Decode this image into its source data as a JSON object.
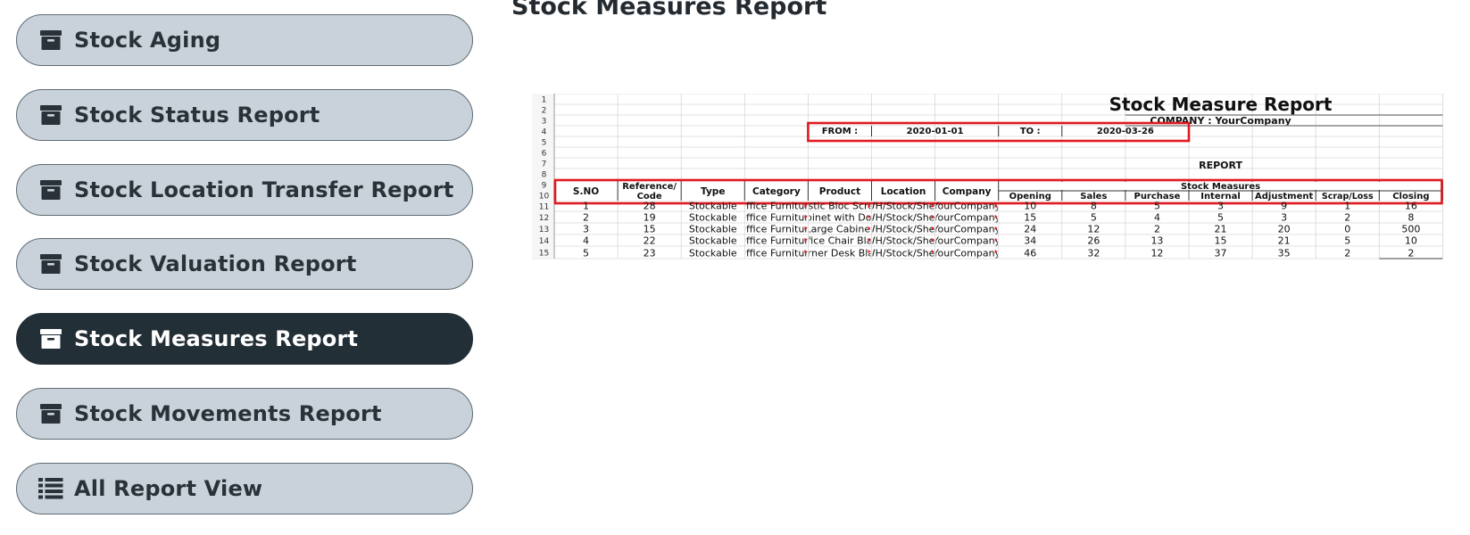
{
  "sidebar": {
    "items": [
      {
        "label": "Stock Aging",
        "icon": "archive-icon",
        "active": false
      },
      {
        "label": "Stock Status Report",
        "icon": "archive-icon",
        "active": false
      },
      {
        "label": "Stock Location Transfer Report",
        "icon": "archive-icon",
        "active": false
      },
      {
        "label": "Stock Valuation Report",
        "icon": "archive-icon",
        "active": false
      },
      {
        "label": "Stock Measures Report",
        "icon": "archive-icon",
        "active": true
      },
      {
        "label": "Stock Movements Report",
        "icon": "archive-icon",
        "active": false
      },
      {
        "label": "All Report View",
        "icon": "list-icon",
        "active": false
      }
    ]
  },
  "page": {
    "title": "Stock Measures Report"
  },
  "spreadsheet": {
    "row_numbers": [
      "1",
      "2",
      "3",
      "4",
      "5",
      "6",
      "7",
      "8",
      "9",
      "10",
      "11",
      "12",
      "13",
      "14",
      "15"
    ],
    "title": "Stock Measure Report",
    "company": "COMPANY : YourCompany",
    "from_label": "FROM :",
    "from_value": "2020-01-01",
    "to_label": "TO :",
    "to_value": "2020-03-26",
    "report_label": "REPORT",
    "group_header": "Stock Measures",
    "columns": [
      "S.NO",
      "Reference/ Code",
      "Type",
      "Category",
      "Product",
      "Location",
      "Company"
    ],
    "measure_columns": [
      "Opening",
      "Sales",
      "Purchase",
      "Internal",
      "Adjustment",
      "Scrap/Loss",
      "Closing"
    ],
    "rows": [
      [
        "1",
        "28",
        "Stockable",
        "Office Furniture",
        "Plastic Bloc Screen",
        "WH/Stock/Shelf",
        "YourCompany",
        "10",
        "8",
        "5",
        "3",
        "9",
        "1",
        "16"
      ],
      [
        "2",
        "19",
        "Stockable",
        "Office Furniture",
        "Cabinet with Doors",
        "WH/Stock/Shelf",
        "YourCompany",
        "15",
        "5",
        "4",
        "5",
        "3",
        "2",
        "8"
      ],
      [
        "3",
        "15",
        "Stockable",
        "Office Furniture",
        "Large Cabinet",
        "WH/Stock/Shelf",
        "YourCompany",
        "24",
        "12",
        "2",
        "21",
        "20",
        "0",
        "500"
      ],
      [
        "4",
        "22",
        "Stockable",
        "Office Furniture",
        "Office Chair Black",
        "WH/Stock/Shelf",
        "YourCompany",
        "34",
        "26",
        "13",
        "15",
        "21",
        "5",
        "10"
      ],
      [
        "5",
        "23",
        "Stockable",
        "Office Furniture",
        "Corner Desk Black",
        "WH/Stock/Shelf",
        "YourCompany",
        "46",
        "32",
        "12",
        "37",
        "35",
        "2",
        "2"
      ]
    ],
    "highlight_color": "#e0191f"
  }
}
